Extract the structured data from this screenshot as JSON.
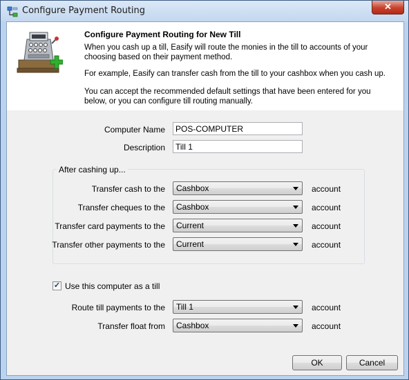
{
  "window": {
    "title": "Configure Payment Routing",
    "close_glyph": "✕"
  },
  "icons": {
    "title_icon": "routing-icon",
    "header_icon": "cash-register-add-icon"
  },
  "header": {
    "title": "Configure Payment Routing for New Till",
    "p1": "When you cash up a till, Easify will route the monies in the till to accounts of your choosing based on their payment method.",
    "p2": "For example, Easify can transfer cash from the till to your cashbox when you cash up.",
    "p3": "You can accept the recommended default settings that have been entered for you below, or you can configure till routing manually."
  },
  "form": {
    "computer_name_label": "Computer Name",
    "computer_name_value": "POS-COMPUTER",
    "description_label": "Description",
    "description_value": "Till 1"
  },
  "group": {
    "legend": "After cashing up...",
    "rows": [
      {
        "label": "Transfer cash to the",
        "value": "Cashbox",
        "suffix": "account"
      },
      {
        "label": "Transfer cheques to the",
        "value": "Cashbox",
        "suffix": "account"
      },
      {
        "label": "Transfer card payments to the",
        "value": "Current",
        "suffix": "account"
      },
      {
        "label": "Transfer other payments to the",
        "value": "Current",
        "suffix": "account"
      }
    ]
  },
  "till": {
    "checkbox_label": "Use this computer as a till",
    "checkbox_checked": true,
    "check_glyph": "✓",
    "route_label": "Route till payments to the",
    "route_value": "Till 1",
    "route_suffix": "account",
    "float_label": "Transfer float from",
    "float_value": "Cashbox",
    "float_suffix": "account"
  },
  "buttons": {
    "ok": "OK",
    "cancel": "Cancel"
  },
  "colors": {
    "title_bar": "#c3d7ef",
    "close_button": "#c7412c",
    "dialog_bg": "#f0f0f0",
    "accent_green": "#2fb12f"
  }
}
